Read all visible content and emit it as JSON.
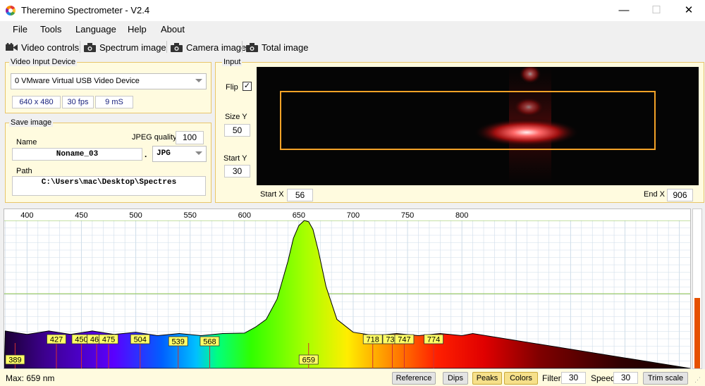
{
  "window": {
    "title": "Theremino Spectrometer - V2.4",
    "min": "—",
    "max": "☐",
    "close": "✕"
  },
  "menu": [
    "File",
    "Tools",
    "Language",
    "Help",
    "About"
  ],
  "toolbar": {
    "video_controls": "Video controls",
    "spectrum_image": "Spectrum image",
    "camera_image": "Camera image",
    "total_image": "Total image"
  },
  "video_input": {
    "label": "Video Input Device",
    "device": "0 VMware Virtual USB Video Device",
    "resolution": "640 x 480",
    "fps": "30 fps",
    "exposure": "9 mS"
  },
  "save_image": {
    "label": "Save image",
    "name_label": "Name",
    "name_value": "Noname_03",
    "jpeg_quality_label": "JPEG quality",
    "jpeg_quality": "100",
    "dot": ".",
    "format": "JPG",
    "path_label": "Path",
    "path_value": "C:\\Users\\mac\\Desktop\\Spectres"
  },
  "input": {
    "label": "Input",
    "flip_label": "Flip",
    "flip_checked": true,
    "size_y_label": "Size Y",
    "size_y": "50",
    "start_y_label": "Start Y",
    "start_y": "30",
    "start_x_label": "Start X",
    "start_x": "56",
    "end_x_label": "End X",
    "end_x": "906"
  },
  "chart_data": {
    "type": "area",
    "x_ticks": [
      400,
      450,
      500,
      550,
      600,
      650,
      700,
      750,
      800
    ],
    "xlim": [
      379,
      1010
    ],
    "ylim": [
      0,
      100
    ],
    "x": [
      380,
      400,
      420,
      440,
      460,
      480,
      500,
      520,
      540,
      560,
      580,
      600,
      610,
      620,
      630,
      640,
      645,
      650,
      655,
      659,
      663,
      668,
      675,
      685,
      700,
      720,
      740,
      760,
      780,
      800,
      810
    ],
    "y": [
      12,
      11,
      12,
      11,
      12,
      11,
      11,
      10,
      10,
      10,
      10,
      12,
      15,
      22,
      38,
      68,
      86,
      96,
      100,
      99,
      93,
      76,
      48,
      22,
      11,
      10,
      10,
      10,
      10,
      10,
      10
    ],
    "peaks": [
      "389",
      "427",
      "450",
      "464",
      "475",
      "504",
      "539",
      "568",
      "659",
      "718",
      "736",
      "747",
      "774"
    ],
    "peak_nm": [
      389,
      427,
      450,
      464,
      475,
      504,
      539,
      568,
      659,
      718,
      736,
      747,
      774
    ],
    "peak_label_row": [
      "bottom",
      "top",
      "top",
      "top",
      "top",
      "top",
      "mid",
      "mid",
      "bottom",
      "top",
      "top",
      "top",
      "top"
    ],
    "grid": true,
    "colors": {
      "trace": "#000000",
      "grid": "#cfdde9",
      "ref_line": "#8bc34a",
      "peak_marker": "#d32f2f",
      "label_bg": "#ffff66"
    }
  },
  "status": {
    "max": "Max: 659 nm",
    "reference": "Reference",
    "dips": "Dips",
    "peaks": "Peaks",
    "colors": "Colors",
    "filter_label": "Filter",
    "filter": "30",
    "speed_label": "Speed",
    "speed": "30",
    "trim": "Trim scale"
  }
}
